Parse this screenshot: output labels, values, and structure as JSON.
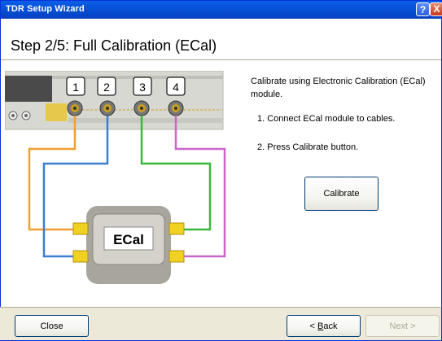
{
  "window": {
    "title": "TDR Setup Wizard",
    "help_glyph": "?",
    "close_glyph": "X"
  },
  "header": {
    "step_title": "Step 2/5: Full Calibration (ECal)"
  },
  "diagram": {
    "ports": [
      "1",
      "2",
      "3",
      "4"
    ],
    "module_label": "ECal",
    "cable_colors": {
      "port1": "#f0a030",
      "port2": "#3a7fd0",
      "port3": "#3cb83c",
      "port4": "#cc66cc"
    }
  },
  "instructions": {
    "description": "Calibrate using Electronic Calibration (ECal) module.",
    "step1": "1. Connect ECal module to cables.",
    "step2": "2. Press Calibrate button."
  },
  "buttons": {
    "calibrate": "Calibrate",
    "close": "Close",
    "back_prefix": "< ",
    "back_accel": "B",
    "back_rest": "ack",
    "next": "Next >"
  }
}
